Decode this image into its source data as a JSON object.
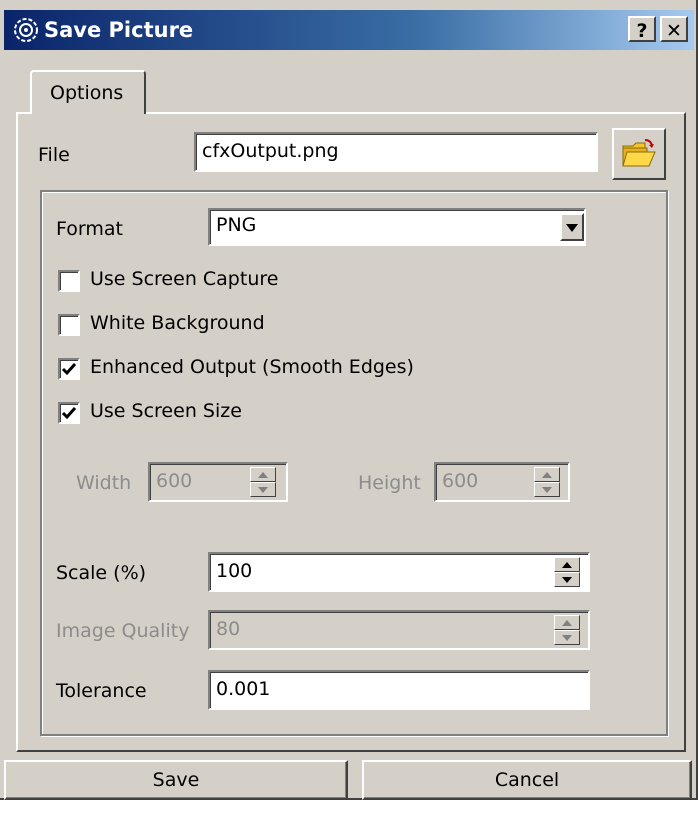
{
  "window": {
    "title": "Save Picture",
    "help_label": "?",
    "close_label": "✕"
  },
  "tabs": [
    {
      "label": "Options"
    }
  ],
  "file": {
    "label": "File",
    "value": "cfxOutput.png"
  },
  "format": {
    "label": "Format",
    "value": "PNG"
  },
  "checkboxes": [
    {
      "label": "Use Screen Capture",
      "checked": false
    },
    {
      "label": "White Background",
      "checked": false
    },
    {
      "label": "Enhanced Output (Smooth Edges)",
      "checked": true
    },
    {
      "label": "Use Screen Size",
      "checked": true
    }
  ],
  "width": {
    "label": "Width",
    "value": "600",
    "enabled": false
  },
  "height": {
    "label": "Height",
    "value": "600",
    "enabled": false
  },
  "scale": {
    "label": "Scale (%)",
    "value": "100"
  },
  "image_quality": {
    "label": "Image Quality",
    "value": "80",
    "enabled": false
  },
  "tolerance": {
    "label": "Tolerance",
    "value": "0.001"
  },
  "buttons": {
    "save": "Save",
    "cancel": "Cancel"
  },
  "icons": {
    "app": "gear-icon",
    "folder": "open-folder-icon"
  },
  "colors": {
    "title_start": "#0a246a",
    "title_end": "#a6caf0",
    "face": "#d4d0c8"
  }
}
